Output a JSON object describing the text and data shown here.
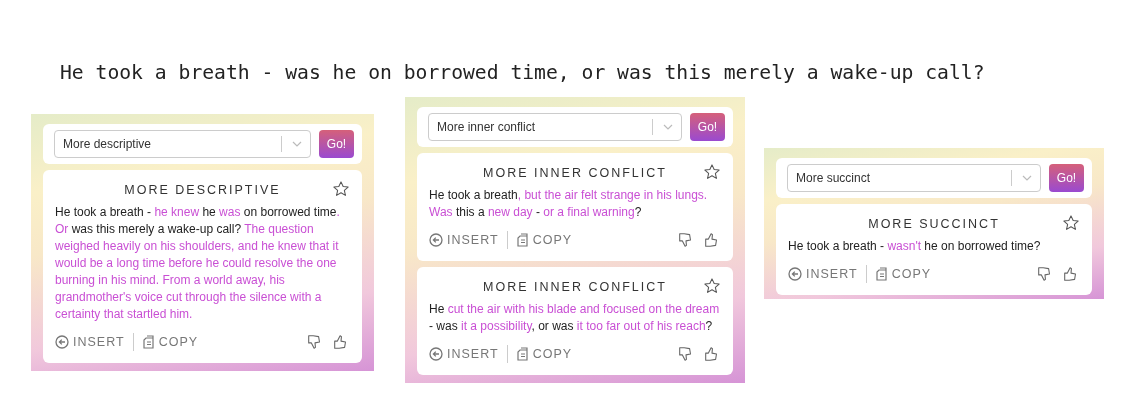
{
  "headline": "He took a breath - was he on borrowed time, or was this merely a wake-up call?",
  "panels": [
    {
      "select": {
        "value": "More descriptive"
      },
      "go_button": "Go!",
      "cards": [
        {
          "title": "MORE DESCRIPTIVE",
          "starred": false,
          "insert": "INSERT",
          "copy": "COPY",
          "segments": [
            {
              "text": "He took a breath - ",
              "changed": false
            },
            {
              "text": "he knew",
              "changed": true
            },
            {
              "text": " he ",
              "changed": false
            },
            {
              "text": "was",
              "changed": true
            },
            {
              "text": " on borrowed time",
              "changed": false
            },
            {
              "text": ". Or",
              "changed": true
            },
            {
              "text": " was this merely a wake-up call? ",
              "changed": false
            },
            {
              "text": "The question weighed heavily on his shoulders, and he knew that it would be a long time before he could resolve the one burning in his mind. From a world away, his grandmother's voice cut through the silence with a certainty that startled him.",
              "changed": true
            }
          ]
        }
      ]
    },
    {
      "select": {
        "value": "More inner conflict"
      },
      "go_button": "Go!",
      "cards": [
        {
          "title": "MORE INNER CONFLICT",
          "starred": false,
          "insert": "INSERT",
          "copy": "COPY",
          "segments": [
            {
              "text": "He took a breath",
              "changed": false
            },
            {
              "text": ", but the air felt strange in his lungs. Was",
              "changed": true
            },
            {
              "text": " this a ",
              "changed": false
            },
            {
              "text": "new day",
              "changed": true
            },
            {
              "text": " - ",
              "changed": false
            },
            {
              "text": "or a final warning",
              "changed": true
            },
            {
              "text": "?",
              "changed": false
            }
          ]
        },
        {
          "title": "MORE INNER CONFLICT",
          "starred": false,
          "insert": "INSERT",
          "copy": "COPY",
          "segments": [
            {
              "text": "He ",
              "changed": false
            },
            {
              "text": "cut the air with his blade and focused on the dream",
              "changed": true
            },
            {
              "text": " - was ",
              "changed": false
            },
            {
              "text": "it a possibility",
              "changed": true
            },
            {
              "text": ", or was ",
              "changed": false
            },
            {
              "text": "it too far out of his reach",
              "changed": true
            },
            {
              "text": "?",
              "changed": false
            }
          ]
        }
      ]
    },
    {
      "select": {
        "value": "More succinct"
      },
      "go_button": "Go!",
      "cards": [
        {
          "title": "MORE SUCCINCT",
          "starred": false,
          "insert": "INSERT",
          "copy": "COPY",
          "segments": [
            {
              "text": "He took a breath - ",
              "changed": false
            },
            {
              "text": "wasn't",
              "changed": true
            },
            {
              "text": " he on borrowed time?",
              "changed": false
            }
          ]
        }
      ]
    }
  ]
}
